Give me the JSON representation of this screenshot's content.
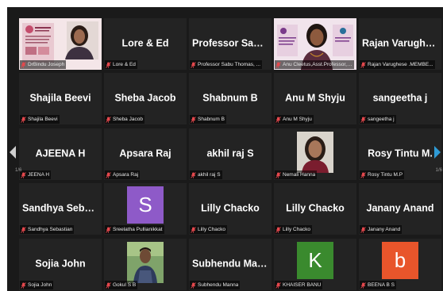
{
  "pagination": {
    "left": "1/6",
    "right": "1/6"
  },
  "tiles": [
    {
      "name": "",
      "label": "DrBindu Joseph",
      "type": "video-slide"
    },
    {
      "name": "Lore & Ed",
      "label": "Lore & Ed",
      "type": "name"
    },
    {
      "name": "Professor Sabu...",
      "label": "Professor Sabu Thomas, ...",
      "type": "name"
    },
    {
      "name": "",
      "label": "Anu Cleetus,Asst.Professor,S...",
      "type": "video-speaker"
    },
    {
      "name": "Rajan Varughes...",
      "label": "Rajan Varughese .MEMBE...",
      "type": "name"
    },
    {
      "name": "Shajila Beevi",
      "label": "Shajila Beevi",
      "type": "name"
    },
    {
      "name": "Sheba Jacob",
      "label": "Sheba Jacob",
      "type": "name"
    },
    {
      "name": "Shabnum B",
      "label": "Shabnum B",
      "type": "name"
    },
    {
      "name": "Anu M Shyju",
      "label": "Anu M Shyju",
      "type": "name"
    },
    {
      "name": "sangeetha j",
      "label": "sangeetha j",
      "type": "name"
    },
    {
      "name": "AJEENA H",
      "label": "JEENA H",
      "type": "name"
    },
    {
      "name": "Apsara Raj",
      "label": "Apsara Raj",
      "type": "name"
    },
    {
      "name": "akhil raj S",
      "label": "akhil raj S",
      "type": "name"
    },
    {
      "name": "",
      "label": "Nemali Hanna",
      "type": "photo-woman"
    },
    {
      "name": "Rosy Tintu M.",
      "label": "Rosy Tintu M.P",
      "type": "name"
    },
    {
      "name": "Sandhya Sebast...",
      "label": "Sandhya Sebastian",
      "type": "name"
    },
    {
      "name": "",
      "label": "Sreelatha Pullianikkat",
      "type": "avatar",
      "letter": "S",
      "color": "#8e5ac8"
    },
    {
      "name": "Lilly Chacko",
      "label": "Lilly Chacko",
      "type": "name"
    },
    {
      "name": "Lilly Chacko",
      "label": "Lilly Chacko",
      "type": "name"
    },
    {
      "name": "Janany Anand",
      "label": "Janany Anand",
      "type": "name"
    },
    {
      "name": "Sojia John",
      "label": "Sojia John",
      "type": "name"
    },
    {
      "name": "",
      "label": "Gokul S B",
      "type": "photo-man"
    },
    {
      "name": "Subhendu Manna",
      "label": "Subhendu Manna",
      "type": "name"
    },
    {
      "name": "",
      "label": "KHAISER BANU",
      "type": "avatar",
      "letter": "K",
      "color": "#3a8a2e"
    },
    {
      "name": "",
      "label": "BEENA B S",
      "type": "avatar",
      "letter": "b",
      "color": "#e8552b"
    }
  ],
  "colors": {
    "active_border": "#e8e23a",
    "mic_muted": "#e5484d",
    "background": "#1a1a1a",
    "tile": "#232323"
  }
}
